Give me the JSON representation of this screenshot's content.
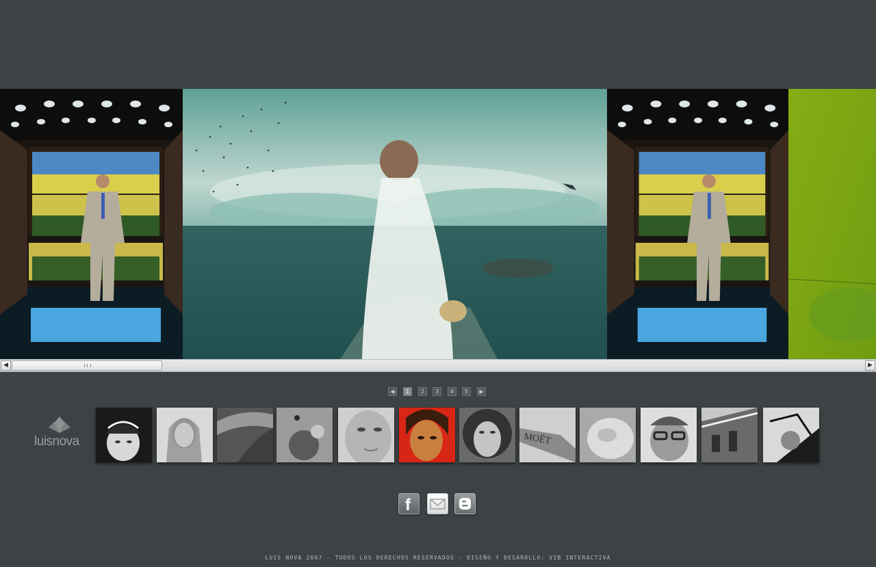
{
  "gallery": {
    "photos": [
      {
        "subject": "groom in elevator"
      },
      {
        "subject": "bride on pier"
      },
      {
        "subject": "groom in elevator"
      },
      {
        "subject": "green backdrop"
      }
    ]
  },
  "scrollbar": {
    "left_arrow": "◀",
    "right_arrow": "▶"
  },
  "pager": {
    "prev_icon": "◀",
    "next_icon": "▶",
    "pages": [
      "1",
      "2",
      "3",
      "4",
      "5"
    ],
    "current": "1"
  },
  "logo": {
    "text": "luisnova"
  },
  "thumbnails": [
    {
      "subject": "bride with tiara"
    },
    {
      "subject": "bride portrait"
    },
    {
      "subject": "sand dunes"
    },
    {
      "subject": "abstract texture"
    },
    {
      "subject": "woman face close-up"
    },
    {
      "subject": "woman on red background"
    },
    {
      "subject": "curly-haired woman looking up"
    },
    {
      "subject": "Moet champagne bottle"
    },
    {
      "subject": "glass macro"
    },
    {
      "subject": "man with glasses"
    },
    {
      "subject": "building facade"
    },
    {
      "subject": "figure on bike"
    }
  ],
  "social": {
    "facebook_icon": "f",
    "email_icon": "envelope-icon",
    "blogger_icon": "blogger-icon"
  },
  "footer": {
    "text": "LUIS NOVA 2007 - TODOS LOS DERECHOS RESERVADOS - DISEÑO Y DESAROLLO: VIB INTERACTIVA"
  },
  "colors": {
    "background": "#3d4244",
    "accent_green": "#86ad14"
  }
}
